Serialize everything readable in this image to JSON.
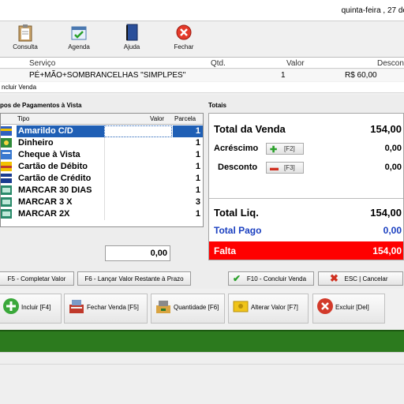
{
  "topbar": {
    "date": "quinta-feira , 27 de"
  },
  "toolbar": {
    "items": [
      {
        "label": "Consulta",
        "icon": "clipboard-icon"
      },
      {
        "label": "Agenda",
        "icon": "calendar-icon"
      },
      {
        "label": "Ajuda",
        "icon": "book-icon"
      },
      {
        "label": "Fechar",
        "icon": "close-icon"
      }
    ]
  },
  "services": {
    "headers": {
      "servico": "Serviço",
      "qtd": "Qtd.",
      "valor": "Valor",
      "desconto": "Descont"
    },
    "row": {
      "servico": "PÉ+MÃO+SOMBRANCELHAS \"SIMPLPES\"",
      "qtd": "1",
      "valor": "R$ 60,00"
    }
  },
  "dialog": {
    "title": "ncluir Venda",
    "payments_title": "pos de Pagamentos à Vista",
    "grid_headers": {
      "tipo": "Tipo",
      "valor": "Valor",
      "parcela": "Parcela"
    },
    "rows": [
      {
        "tipo": "Amarildo C/D",
        "parcela": "1"
      },
      {
        "tipo": "Dinheiro",
        "parcela": "1"
      },
      {
        "tipo": "Cheque à Vista",
        "parcela": "1"
      },
      {
        "tipo": "Cartão de Débito",
        "parcela": "1"
      },
      {
        "tipo": "Cartão de Crédito",
        "parcela": "1"
      },
      {
        "tipo": "MARCAR 30 DIAS",
        "parcela": "1"
      },
      {
        "tipo": "MARCAR 3 X",
        "parcela": "3"
      },
      {
        "tipo": "MARCAR 2X",
        "parcela": "1"
      }
    ],
    "total_value": "0,00",
    "totals_title": "Totais",
    "totals": {
      "total_venda_label": "Total da Venda",
      "total_venda": "154,00",
      "acrescimo_label": "Acréscimo",
      "acrescimo_key": "[F2]",
      "acrescimo": "0,00",
      "desconto_label": "Desconto",
      "desconto_key": "[F3]",
      "desconto": "0,00",
      "total_liq_label": "Total Liq.",
      "total_liq": "154,00",
      "total_pago_label": "Total Pago",
      "total_pago": "0,00",
      "falta_label": "Falta",
      "falta": "154,00"
    },
    "buttons": {
      "f5": "F5 - Completar Valor",
      "f6": "F6 - Lançar Valor Restante à Prazo",
      "f10": "F10 - Concluir Venda",
      "esc": "ESC | Cancelar"
    }
  },
  "actions": [
    {
      "label": "Incluir [F4]",
      "icon": "add-icon"
    },
    {
      "label": "Fechar Venda [F5]",
      "icon": "cash-register-icon"
    },
    {
      "label": "Quantidade [F6]",
      "icon": "quantity-icon"
    },
    {
      "label": "Alterar Valor [F7]",
      "icon": "money-icon"
    },
    {
      "label": "Excluir [Del]",
      "icon": "delete-icon"
    }
  ],
  "colors": {
    "selection": "#1f5fb5",
    "falta_bg": "#ff0000",
    "total_pago": "#1a3fc0",
    "green_bar": "#2c7a1e"
  }
}
